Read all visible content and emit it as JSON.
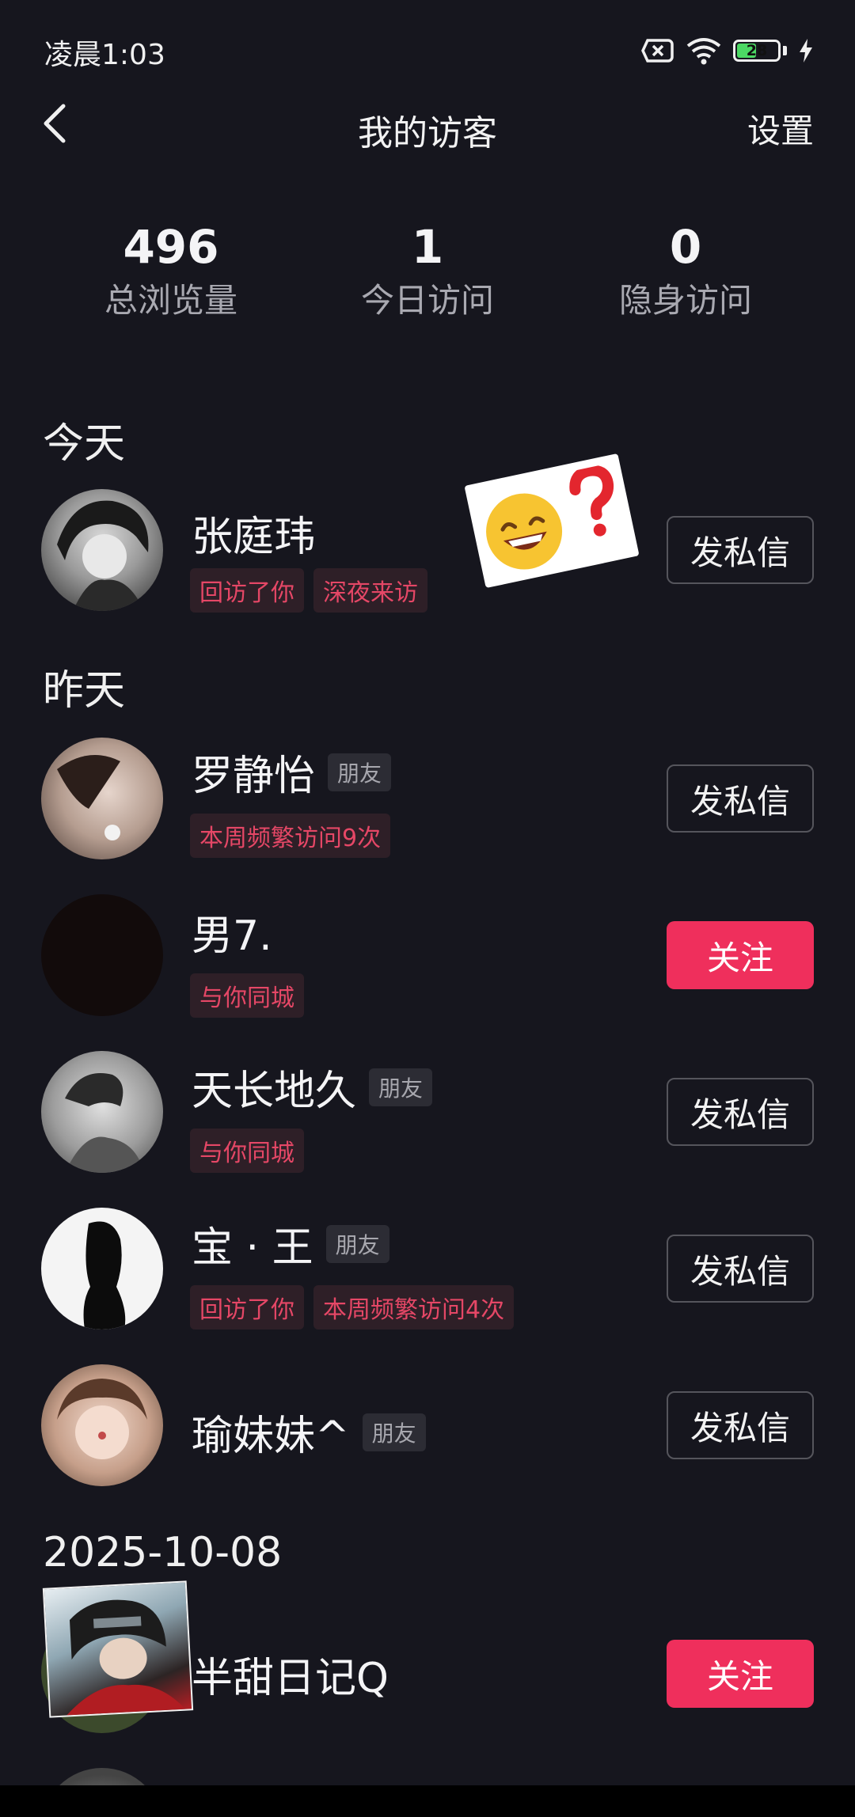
{
  "status": {
    "time": "凌晨1:03",
    "battery": "28"
  },
  "nav": {
    "title": "我的访客",
    "settings": "设置"
  },
  "stats": [
    {
      "value": "496",
      "label": "总浏览量"
    },
    {
      "value": "1",
      "label": "今日访问"
    },
    {
      "value": "0",
      "label": "隐身访问"
    }
  ],
  "sections": {
    "today": "今天",
    "yesterday": "昨天",
    "date": "2025-10-08"
  },
  "visitors": [
    {
      "name": "张庭玮",
      "tags": [
        "回访了你",
        "深夜来访"
      ],
      "action": "发私信"
    },
    {
      "name": "罗静怡",
      "friend": "朋友",
      "tags": [
        "本周频繁访问9次"
      ],
      "action": "发私信"
    },
    {
      "name": "男7.",
      "tags": [
        "与你同城"
      ],
      "action": "关注"
    },
    {
      "name": "天长地久",
      "friend": "朋友",
      "tags": [
        "与你同城"
      ],
      "action": "发私信"
    },
    {
      "name": "宝 · 王",
      "friend": "朋友",
      "tags": [
        "回访了你",
        "本周频繁访问4次"
      ],
      "action": "发私信"
    },
    {
      "name": "瑜妹妹^",
      "friend": "朋友",
      "action": "发私信"
    },
    {
      "name": "半甜日记Q",
      "action": "关注"
    }
  ],
  "colors": {
    "accent": "#ef2f5c",
    "tag_text": "#e54766",
    "background": "#16161e"
  },
  "icons": [
    "back-arrow-icon",
    "sim-off-icon",
    "wifi-icon",
    "battery-icon",
    "charging-icon",
    "grinning-emoji",
    "question-mark-emoji"
  ]
}
